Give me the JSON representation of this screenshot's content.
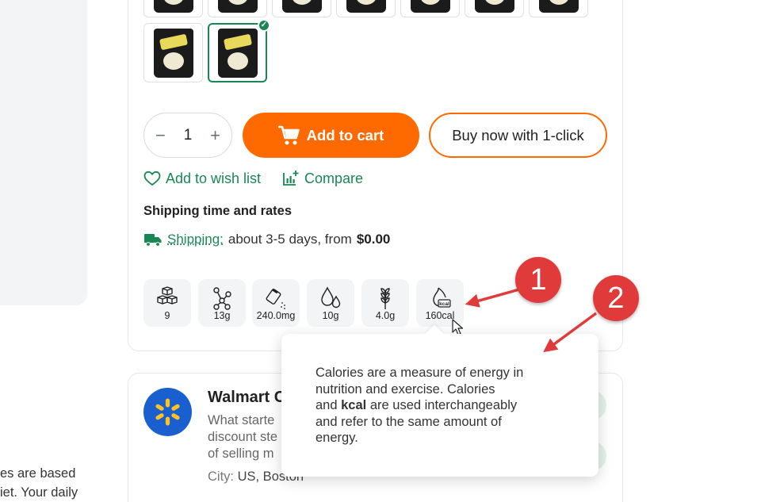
{
  "cart": {
    "quantity": "1",
    "minus": "−",
    "plus": "+",
    "add_to_cart": "Add to cart",
    "buy_now": "Buy now with 1-click",
    "wishlist": "Add to wish list",
    "compare": "Compare"
  },
  "shipping": {
    "title": "Shipping time and rates",
    "link": "Shipping:",
    "text": "about 3-5 days, from",
    "price": "$0.00"
  },
  "nutrition": [
    {
      "icon": "sugar-cubes-icon",
      "value": "9"
    },
    {
      "icon": "molecule-icon",
      "value": "13g"
    },
    {
      "icon": "salt-icon",
      "value": "240.0mg"
    },
    {
      "icon": "fat-drops-icon",
      "value": "10g"
    },
    {
      "icon": "wheat-icon",
      "value": "4.0g"
    },
    {
      "icon": "calories-flame-icon",
      "value": "160cal"
    }
  ],
  "tooltip": {
    "line1": "Calories are a measure of energy in",
    "line2": "nutrition and exercise. Calories",
    "line3_pre": "and ",
    "line3_bold": "kcal",
    "line3_post": " are used interchangeably",
    "line4": "and refer to the same amount of",
    "line5": "energy."
  },
  "store": {
    "name": "Walmart C",
    "desc_line1": "What starte",
    "desc_line2": "discount ste",
    "desc_line3": "of selling m",
    "city_label": "City:",
    "city_value": "US, Boston"
  },
  "left_text": {
    "line1": "es are based",
    "line2": "iet. Your daily"
  },
  "annotations": {
    "callout1": "1",
    "callout2": "2"
  },
  "colors": {
    "accent_orange": "#ff6a00",
    "accent_green": "#198754",
    "callout_red": "#e13a3a",
    "store_blue": "#1a5fd0"
  }
}
